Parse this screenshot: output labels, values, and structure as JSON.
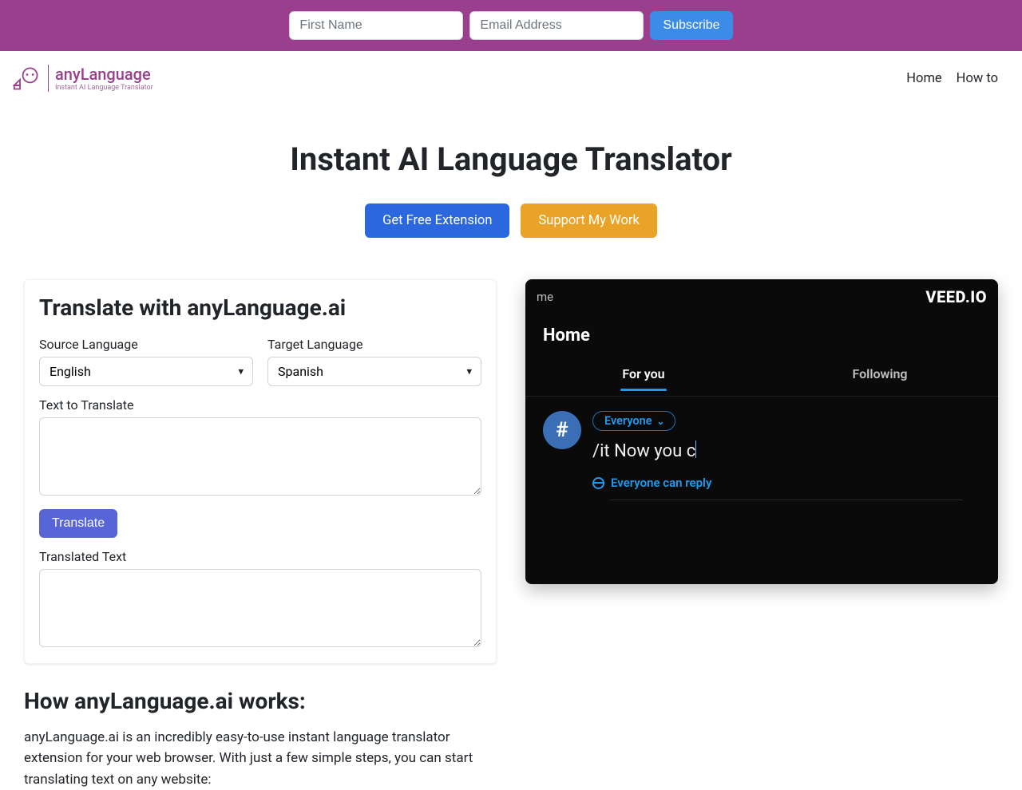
{
  "topbar": {
    "first_name_placeholder": "First Name",
    "email_placeholder": "Email Address",
    "subscribe_label": "Subscribe"
  },
  "nav": {
    "brand": "anyLanguage",
    "brand_sub": "Instant AI Language Translator",
    "home": "Home",
    "howto": "How to"
  },
  "hero": {
    "title": "Instant AI Language Translator",
    "get_ext": "Get Free Extension",
    "support": "Support My Work"
  },
  "card": {
    "title": "Translate with anyLanguage.ai",
    "source_label": "Source Language",
    "target_label": "Target Language",
    "source_value": "English",
    "target_value": "Spanish",
    "text_label": "Text to Translate",
    "translate_btn": "Translate",
    "translated_label": "Translated Text"
  },
  "demo": {
    "veed": "VEED.IO",
    "me": "me",
    "home": "Home",
    "tab_foryou": "For you",
    "tab_following": "Following",
    "avatar_glyph": "#",
    "audience": "Everyone",
    "compose": "/it Now you c",
    "reply": "Everyone can reply"
  },
  "how": {
    "title": "How anyLanguage.ai works:",
    "body": "anyLanguage.ai is an incredibly easy-to-use instant language translator extension for your web browser. With just a few simple steps, you can start translating text on any website:"
  }
}
